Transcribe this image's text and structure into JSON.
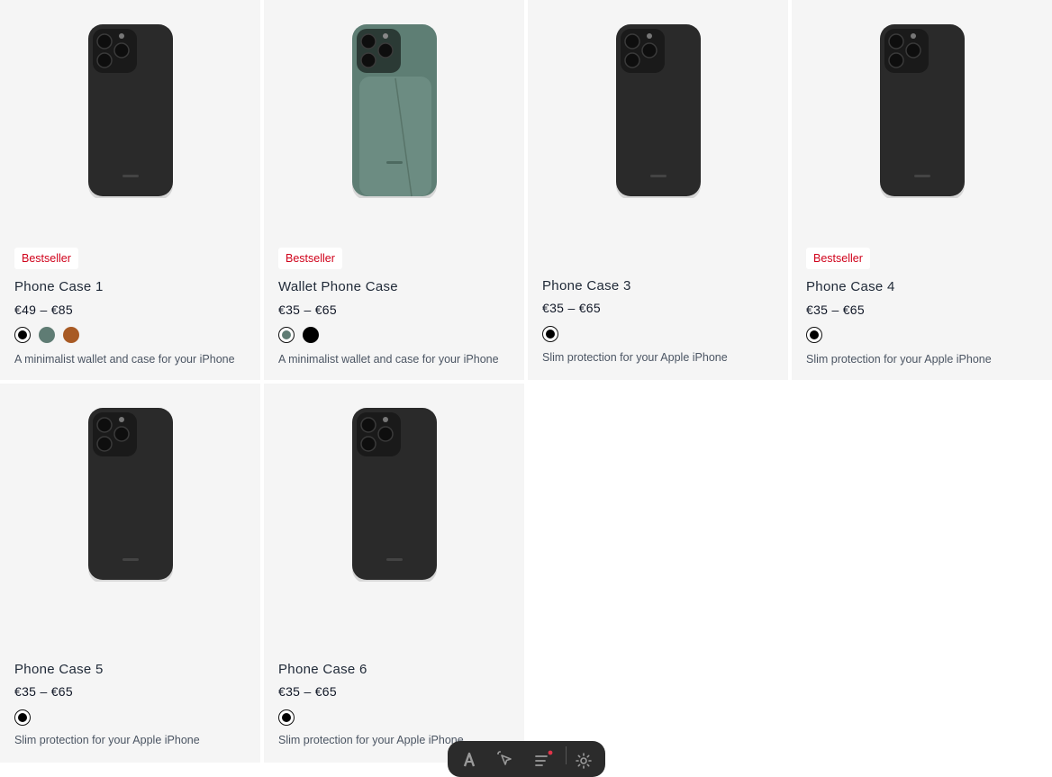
{
  "products": [
    {
      "badge": "Bestseller",
      "title": "Phone Case 1",
      "price": "€49 – €85",
      "description": "A minimalist wallet and case for your iPhone",
      "image_color": "#2a2a2a",
      "has_wallet": false,
      "swatches": [
        {
          "color": "#000000",
          "selected": true
        },
        {
          "color": "#5f7c74",
          "selected": false
        },
        {
          "color": "#a85a24",
          "selected": false
        }
      ]
    },
    {
      "badge": "Bestseller",
      "title": "Wallet Phone Case",
      "price": "€35 – €65",
      "description": "A minimalist wallet and case for your iPhone",
      "image_color": "#5e7e74",
      "has_wallet": true,
      "swatches": [
        {
          "color": "#5f7c74",
          "selected": true
        },
        {
          "color": "#000000",
          "selected": false
        }
      ]
    },
    {
      "badge": "",
      "title": "Phone Case 3",
      "price": "€35 – €65",
      "description": "Slim protection for your Apple iPhone",
      "image_color": "#2a2a2a",
      "has_wallet": false,
      "swatches": [
        {
          "color": "#000000",
          "selected": true
        }
      ]
    },
    {
      "badge": "Bestseller",
      "title": "Phone Case 4",
      "price": "€35 – €65",
      "description": "Slim protection for your Apple iPhone",
      "image_color": "#2a2a2a",
      "has_wallet": false,
      "swatches": [
        {
          "color": "#000000",
          "selected": true
        }
      ]
    },
    {
      "badge": "",
      "title": "Phone Case 5",
      "price": "€35 – €65",
      "description": "Slim protection for your Apple iPhone",
      "image_color": "#2a2a2a",
      "has_wallet": false,
      "swatches": [
        {
          "color": "#000000",
          "selected": true
        }
      ]
    },
    {
      "badge": "",
      "title": "Phone Case 6",
      "price": "€35 – €65",
      "description": "Slim protection for your Apple iPhone",
      "image_color": "#2a2a2a",
      "has_wallet": false,
      "swatches": [
        {
          "color": "#000000",
          "selected": true
        }
      ]
    }
  ],
  "colors": {
    "card_background": "#f5f5f5",
    "badge_text": "#d0021b",
    "toolbar_background": "#2b2b2b"
  },
  "toolbar": {
    "items": [
      {
        "icon": "astro-logo-icon"
      },
      {
        "icon": "inspect-cursor-icon"
      },
      {
        "icon": "audit-list-icon"
      },
      {
        "icon": "settings-gear-icon"
      }
    ]
  }
}
